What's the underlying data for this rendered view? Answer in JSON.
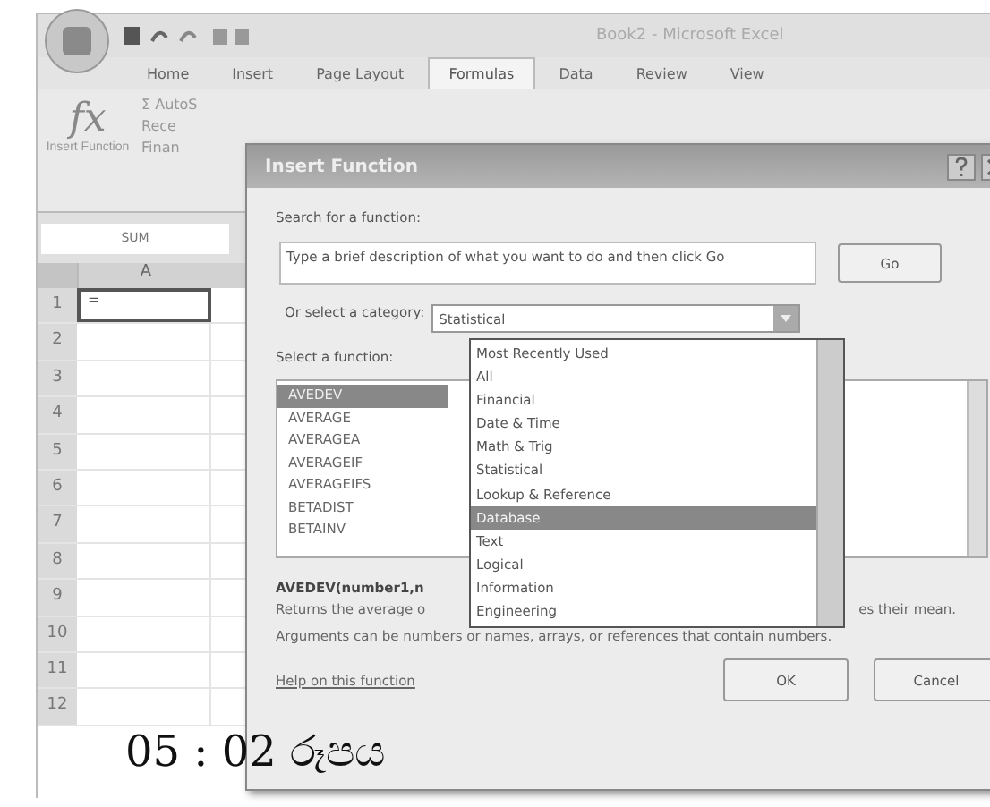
{
  "window": {
    "title": "Book2 - Microsoft Excel"
  },
  "ribbon_tabs": [
    {
      "label": "Home",
      "selected": false
    },
    {
      "label": "Insert",
      "selected": false
    },
    {
      "label": "Page Layout",
      "selected": false
    },
    {
      "label": "Formulas",
      "selected": true
    },
    {
      "label": "Data",
      "selected": false
    },
    {
      "label": "Review",
      "selected": false
    },
    {
      "label": "View",
      "selected": false
    }
  ],
  "ribbon": {
    "fx_symbol": "fx",
    "sigma": "Σ",
    "insert_function": "Insert Function",
    "autosum": "AutoS",
    "recent": "Rece",
    "financial": "Finan"
  },
  "name_box": "SUM",
  "sheet": {
    "columns": [
      "A"
    ],
    "rows": [
      "1",
      "2",
      "3",
      "4",
      "5",
      "6",
      "7",
      "8",
      "9",
      "10",
      "11",
      "12"
    ],
    "cell_a1": "="
  },
  "dialog": {
    "title": "Insert Function",
    "search_label": "Search for a function:",
    "search_value": "Type a brief description of what you want to do and then click Go",
    "go_button": "Go",
    "category_label": "Or select a category:",
    "category_value": "Statistical",
    "category_options": [
      {
        "label": "Most Recently Used",
        "selected": false
      },
      {
        "label": "All",
        "selected": false
      },
      {
        "label": "Financial",
        "selected": false
      },
      {
        "label": "Date & Time",
        "selected": false
      },
      {
        "label": "Math & Trig",
        "selected": false
      },
      {
        "label": "Statistical",
        "selected": false
      },
      {
        "label": "Lookup & Reference",
        "selected": false
      },
      {
        "label": "Database",
        "selected": true
      },
      {
        "label": "Text",
        "selected": false
      },
      {
        "label": "Logical",
        "selected": false
      },
      {
        "label": "Information",
        "selected": false
      },
      {
        "label": "Engineering",
        "selected": false
      }
    ],
    "function_label": "Select a function:",
    "functions": [
      {
        "label": "AVEDEV",
        "selected": true
      },
      {
        "label": "AVERAGE",
        "selected": false
      },
      {
        "label": "AVERAGEA",
        "selected": false
      },
      {
        "label": "AVERAGEIF",
        "selected": false
      },
      {
        "label": "AVERAGEIFS",
        "selected": false
      },
      {
        "label": "BETADIST",
        "selected": false
      },
      {
        "label": "BETAINV",
        "selected": false
      }
    ],
    "syntax": "AVEDEV(number1,n",
    "description_start": "Returns the average o",
    "description_end": "es their mean.",
    "description_rest": "Arguments can be numbers or names, arrays, or references that contain numbers.",
    "help_link": "Help on this function",
    "ok_button": "OK",
    "cancel_button": "Cancel"
  },
  "caption": "05 : 02 රූපය"
}
